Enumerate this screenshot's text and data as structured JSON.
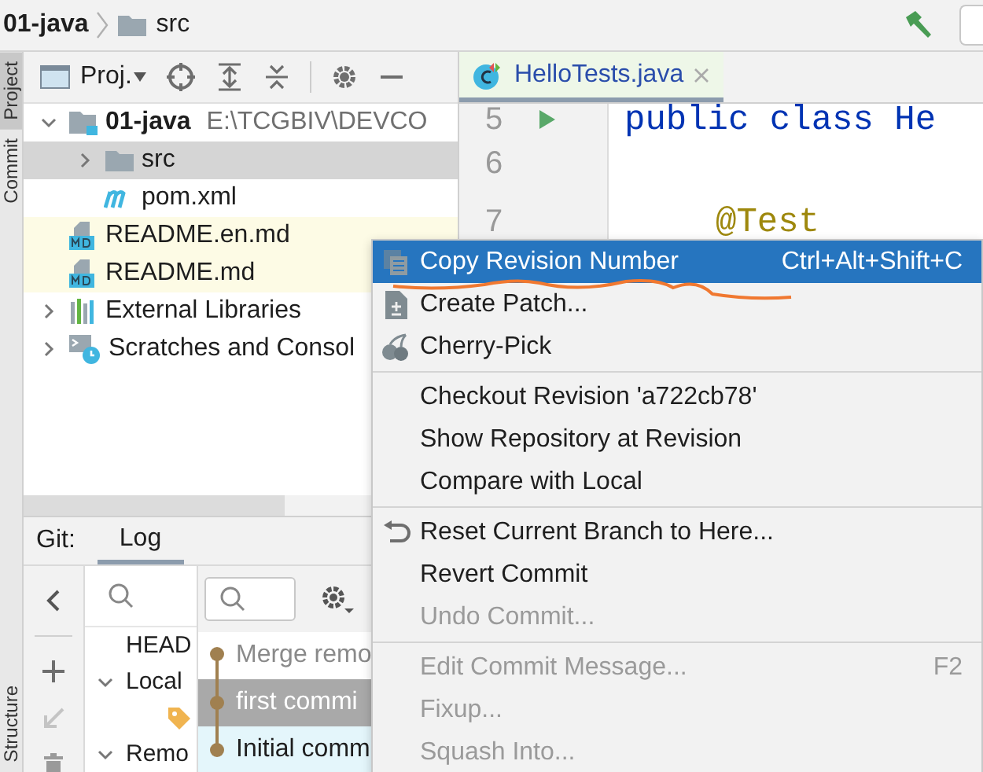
{
  "breadcrumb": [
    {
      "label": "01-java",
      "kind": "project"
    },
    {
      "label": "src",
      "kind": "folder"
    }
  ],
  "side_tabs": [
    {
      "label": "Project",
      "selected": true
    },
    {
      "label": "Commit",
      "selected": false
    },
    {
      "label": "Structure",
      "selected": false
    }
  ],
  "project_panel": {
    "title": "Proj.",
    "tree": [
      {
        "label": "01-java",
        "path": "E:\\TCGBIV\\DEVCO",
        "kind": "module",
        "expanded": true,
        "selected": false,
        "highlighted": false,
        "children": [
          {
            "label": "src",
            "kind": "folder",
            "expanded": false,
            "selected": true,
            "highlighted": false
          },
          {
            "label": "pom.xml",
            "kind": "maven",
            "selected": false,
            "highlighted": false
          }
        ]
      },
      {
        "label": "README.en.md",
        "kind": "markdown",
        "selected": false,
        "highlighted": true
      },
      {
        "label": "README.md",
        "kind": "markdown",
        "selected": false,
        "highlighted": true
      },
      {
        "label": "External Libraries",
        "kind": "libraries",
        "expanded": false,
        "selected": false,
        "highlighted": false
      },
      {
        "label": "Scratches and Consol",
        "kind": "scratches",
        "expanded": false,
        "selected": false,
        "highlighted": false
      }
    ]
  },
  "editor": {
    "tab": {
      "label": "HelloTests.java",
      "selected": true
    },
    "lines": [
      {
        "number": "5",
        "code": "public class He",
        "kind": "keyword",
        "runnable": true
      },
      {
        "number": "6"
      },
      {
        "number": "7",
        "code": "@Test",
        "kind": "annotation"
      }
    ]
  },
  "git": {
    "title": "Git:",
    "tabs": [
      {
        "label": "Log",
        "selected": true
      }
    ],
    "branches": [
      {
        "label": "HEAD",
        "kind": "ref"
      },
      {
        "label": "Local",
        "kind": "group",
        "expanded": true
      },
      {
        "kind": "branch"
      },
      {
        "label": "Remo",
        "kind": "group",
        "expanded": true
      }
    ],
    "commits": [
      {
        "message": "Merge remo",
        "selected": false,
        "highlighted": false,
        "kind": "merge"
      },
      {
        "message": "first commi",
        "selected": true,
        "highlighted": false,
        "kind": "commit"
      },
      {
        "message": "Initial comm",
        "selected": false,
        "highlighted": true,
        "kind": "commit"
      }
    ]
  },
  "context_menu": [
    {
      "kind": "copy",
      "label": "Copy Revision Number",
      "shortcut": "Ctrl+Alt+Shift+C",
      "selected": true,
      "enabled": true
    },
    {
      "kind": "patch",
      "label": "Create Patch...",
      "selected": false,
      "enabled": true
    },
    {
      "kind": "cherry",
      "label": "Cherry-Pick",
      "selected": false,
      "enabled": true
    },
    {
      "kind": "separator"
    },
    {
      "kind": "plain",
      "label": "Checkout Revision 'a722cb78'",
      "selected": false,
      "enabled": true
    },
    {
      "kind": "plain",
      "label": "Show Repository at Revision",
      "selected": false,
      "enabled": true
    },
    {
      "kind": "plain",
      "label": "Compare with Local",
      "selected": false,
      "enabled": true
    },
    {
      "kind": "separator"
    },
    {
      "kind": "reset",
      "label": "Reset Current Branch to Here...",
      "selected": false,
      "enabled": true
    },
    {
      "kind": "plain",
      "label": "Revert Commit",
      "selected": false,
      "enabled": true
    },
    {
      "kind": "plain",
      "label": "Undo Commit...",
      "selected": false,
      "enabled": false
    },
    {
      "kind": "separator"
    },
    {
      "kind": "plain",
      "label": "Edit Commit Message...",
      "shortcut": "F2",
      "selected": false,
      "enabled": false
    },
    {
      "kind": "plain",
      "label": "Fixup...",
      "selected": false,
      "enabled": false
    },
    {
      "kind": "plain",
      "label": "Squash Into...",
      "selected": false,
      "enabled": false
    }
  ]
}
